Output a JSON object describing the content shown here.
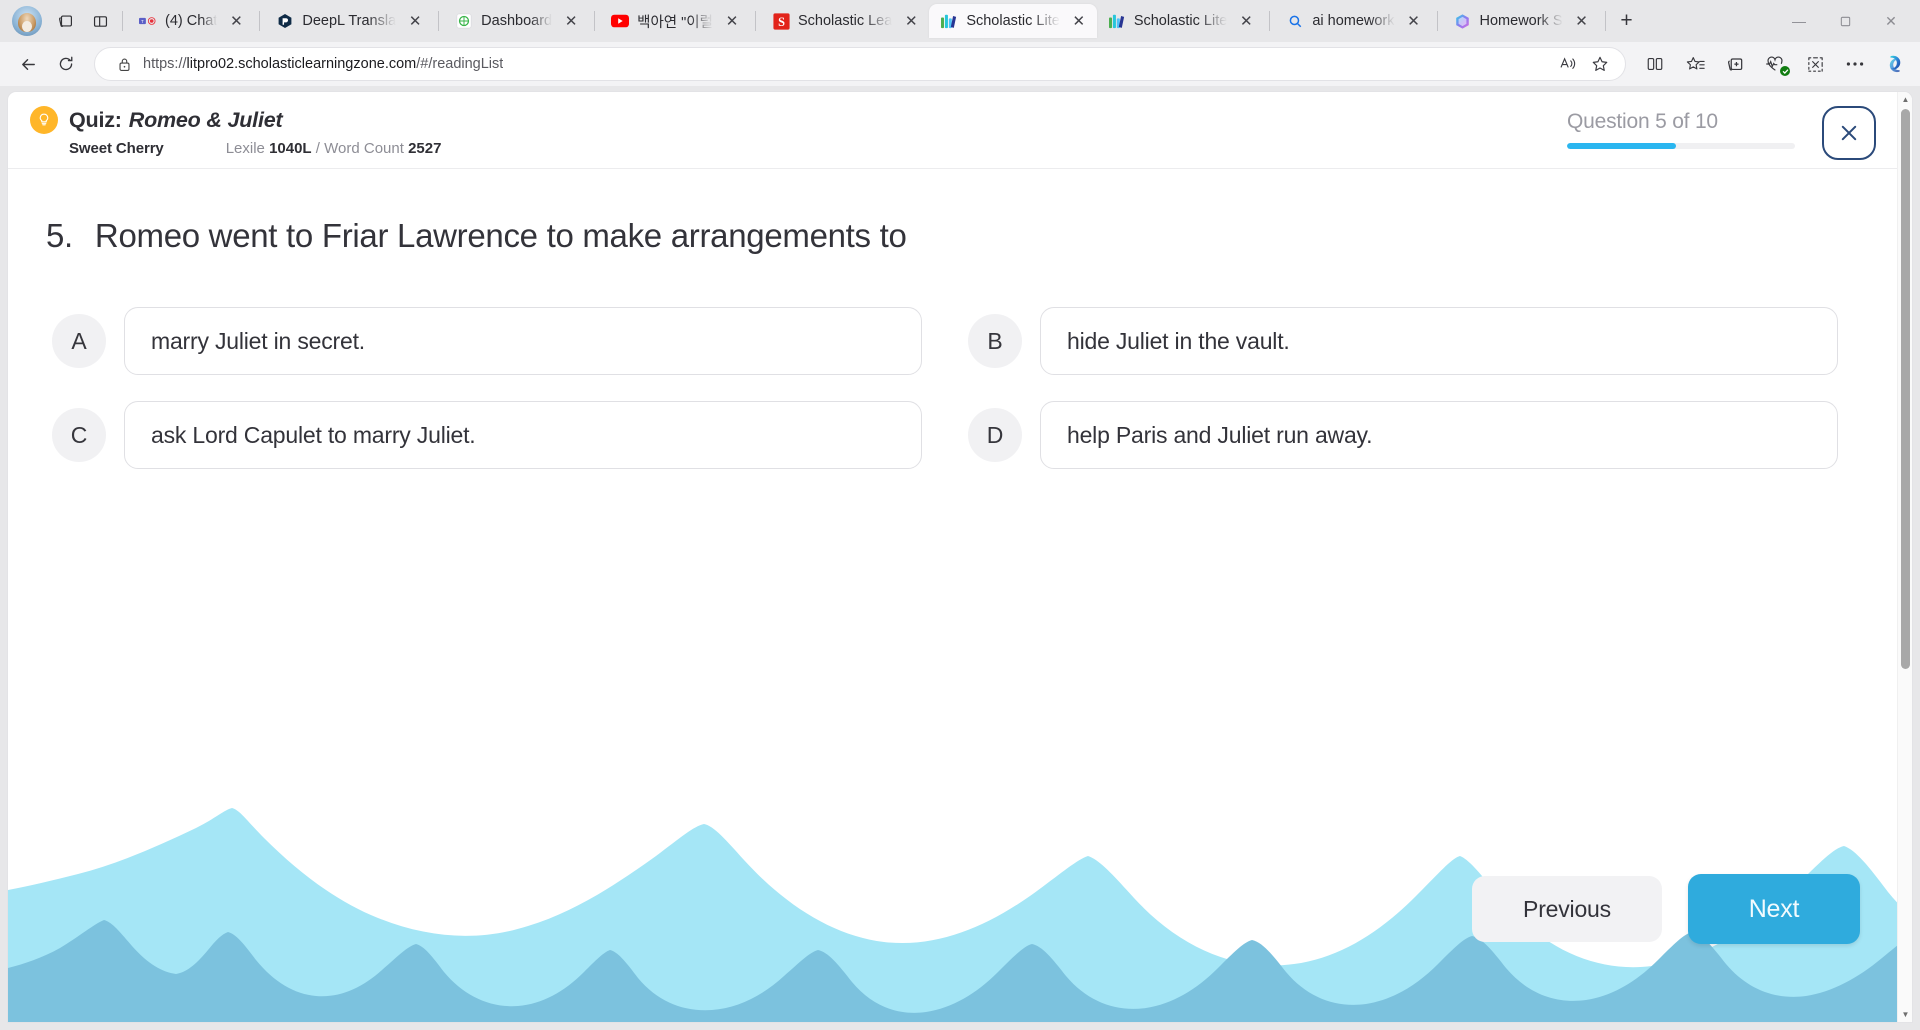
{
  "browser": {
    "toolbar_left_icons": [
      "profile-avatar",
      "collections-icon",
      "split-screen-icon"
    ],
    "tabs": [
      {
        "title": "(4) Chat",
        "favicon": "teams-record-icon",
        "active": false
      },
      {
        "title": "DeepL Transla",
        "favicon": "deepl-icon",
        "active": false
      },
      {
        "title": "Dashboard",
        "favicon": "dashboard-icon",
        "active": false
      },
      {
        "title": "백아연 \"이럴",
        "favicon": "youtube-icon",
        "active": false
      },
      {
        "title": "Scholastic Lea",
        "favicon": "scholastic-s-icon",
        "active": false
      },
      {
        "title": "Scholastic Lite",
        "favicon": "scholastic-books-icon",
        "active": true
      },
      {
        "title": "Scholastic Lite",
        "favicon": "scholastic-books-icon",
        "active": false
      },
      {
        "title": "ai homework",
        "favicon": "search-icon",
        "active": false
      },
      {
        "title": "Homework S",
        "favicon": "copilot-icon",
        "active": false
      }
    ],
    "new_tab_label": "+",
    "window_controls": {
      "minimize": "—",
      "maximize": "❐",
      "close": "✕"
    },
    "nav": {
      "back": "←",
      "reload": "↻"
    },
    "url": "https://litpro02.scholasticlearningzone.com/#/readingList",
    "url_domain": "litpro02.scholasticlearningzone.com",
    "url_scheme": "https://",
    "url_path": "/#/readingList",
    "omnibox_icons": [
      "read-aloud-icon",
      "favorite-star-icon"
    ],
    "toolbar_right_icons": [
      "split-screen-icon",
      "favorites-icon",
      "collections-icon",
      "browser-essentials-icon",
      "screenshot-icon",
      "settings-more-icon",
      "copilot-icon"
    ]
  },
  "quiz": {
    "icon": "lightbulb-icon",
    "title_prefix": "Quiz:",
    "book_title": "Romeo & Juliet",
    "author": "Sweet Cherry",
    "lexile_label": "Lexile",
    "lexile_value": "1040L",
    "separator": "/",
    "word_count_label": "Word Count",
    "word_count_value": "2527",
    "progress_label": "Question 5 of 10",
    "progress_percent": 48,
    "close_label": "✕",
    "current_question": 5,
    "total_questions": 10
  },
  "question": {
    "number": "5.",
    "text": "Romeo went to Friar Lawrence to make arrangements to",
    "options": [
      {
        "letter": "A",
        "text": "marry Juliet in secret."
      },
      {
        "letter": "B",
        "text": "hide Juliet in the vault."
      },
      {
        "letter": "C",
        "text": "ask Lord Capulet to marry Juliet."
      },
      {
        "letter": "D",
        "text": "help Paris and Juliet run away."
      }
    ]
  },
  "footer": {
    "previous_label": "Previous",
    "next_label": "Next"
  },
  "colors": {
    "accent_blue": "#2fabdd",
    "progress_blue": "#2ab6f0",
    "bulb_yellow": "#ffb629",
    "wave_light": "#a5e6f6",
    "wave_dark": "#7cc2de",
    "close_border": "#2b4a7a"
  }
}
